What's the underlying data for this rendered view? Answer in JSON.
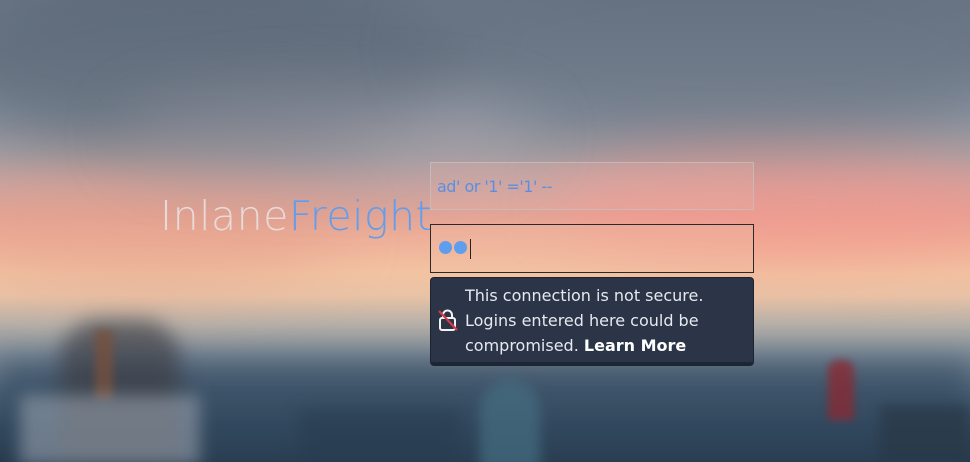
{
  "logo": {
    "part_a": "Inlane",
    "part_b": "Freight"
  },
  "login": {
    "username_value": "ad' or '1' ='1' --",
    "password_masked_dots": 2
  },
  "insecure_warning": {
    "icon": "insecure-lock-icon",
    "line1": "This connection is not secure.",
    "line2": "Logins entered here could be",
    "line3": "compromised.",
    "learn_more": "Learn More"
  },
  "colors": {
    "brand_blue": "#5f9dee",
    "popup_bg": "#2b3547",
    "warning_red": "#d63a4a"
  }
}
